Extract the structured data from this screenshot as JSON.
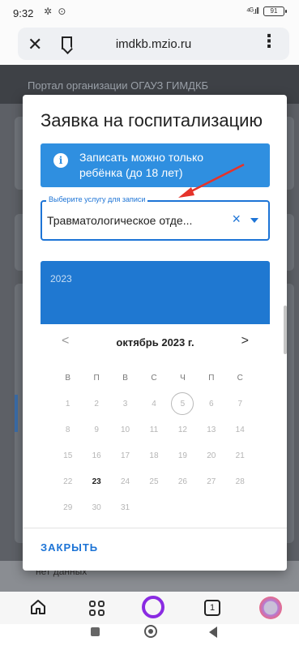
{
  "status_bar": {
    "time": "9:32",
    "notification_icons": "✲ ⊙",
    "signal": "⁴ᴳ.ıll",
    "battery": "91"
  },
  "browser": {
    "url": "imdkb.mzio.ru",
    "close_icon": "close-icon",
    "bookmark_icon": "bookmark-icon",
    "menu_icon": "more-vert-icon"
  },
  "background_page": {
    "portal_title": "Портал организации ОГАУЗ ГИМДКБ",
    "no_data": "нет данных"
  },
  "modal": {
    "title": "Заявка на госпитализацию",
    "info_text": "Записать можно только ребёнка (до 18 лет)",
    "select": {
      "label": "Выберите услугу для записи",
      "value": "Травматологическое отде...",
      "clear_icon": "×"
    },
    "calendar": {
      "year": "2023",
      "month_label": "октябрь 2023 г.",
      "prev": "<",
      "next": ">",
      "weekdays": [
        "В",
        "П",
        "В",
        "С",
        "Ч",
        "П",
        "С"
      ],
      "weeks": [
        [
          "1",
          "2",
          "3",
          "4",
          "5",
          "6",
          "7"
        ],
        [
          "8",
          "9",
          "10",
          "11",
          "12",
          "13",
          "14"
        ],
        [
          "15",
          "16",
          "17",
          "18",
          "19",
          "20",
          "21"
        ],
        [
          "22",
          "23",
          "24",
          "25",
          "26",
          "27",
          "28"
        ],
        [
          "29",
          "30",
          "31",
          "",
          "",
          "",
          ""
        ]
      ],
      "today": "5",
      "available": [
        "23"
      ]
    },
    "close_label": "ЗАКРЫТЬ"
  },
  "browser_nav": {
    "tabs_count": "1"
  },
  "colors": {
    "accent": "#1d74d6",
    "banner": "#2f8fe0",
    "annotation_arrow": "#e5332a"
  }
}
